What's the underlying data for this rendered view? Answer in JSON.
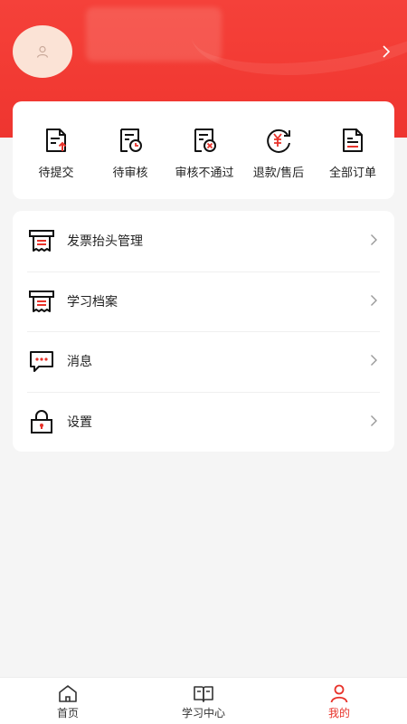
{
  "orders": [
    {
      "label": "待提交",
      "icon": "doc-upload-icon"
    },
    {
      "label": "待审核",
      "icon": "doc-clock-icon"
    },
    {
      "label": "审核不通过",
      "icon": "doc-reject-icon"
    },
    {
      "label": "退款/售后",
      "icon": "refund-yuan-icon"
    },
    {
      "label": "全部订单",
      "icon": "doc-list-icon"
    }
  ],
  "menu": [
    {
      "label": "发票抬头管理",
      "icon": "invoice-icon"
    },
    {
      "label": "学习档案",
      "icon": "archive-icon"
    },
    {
      "label": "消息",
      "icon": "message-icon"
    },
    {
      "label": "设置",
      "icon": "lock-icon"
    }
  ],
  "tabs": [
    {
      "label": "首页",
      "icon": "home-icon"
    },
    {
      "label": "学习中心",
      "icon": "book-icon"
    },
    {
      "label": "我的",
      "icon": "user-icon"
    }
  ],
  "colors": {
    "accent": "#e8332b",
    "header": "#f23a33",
    "avatar_bg": "#fbe3d6"
  }
}
